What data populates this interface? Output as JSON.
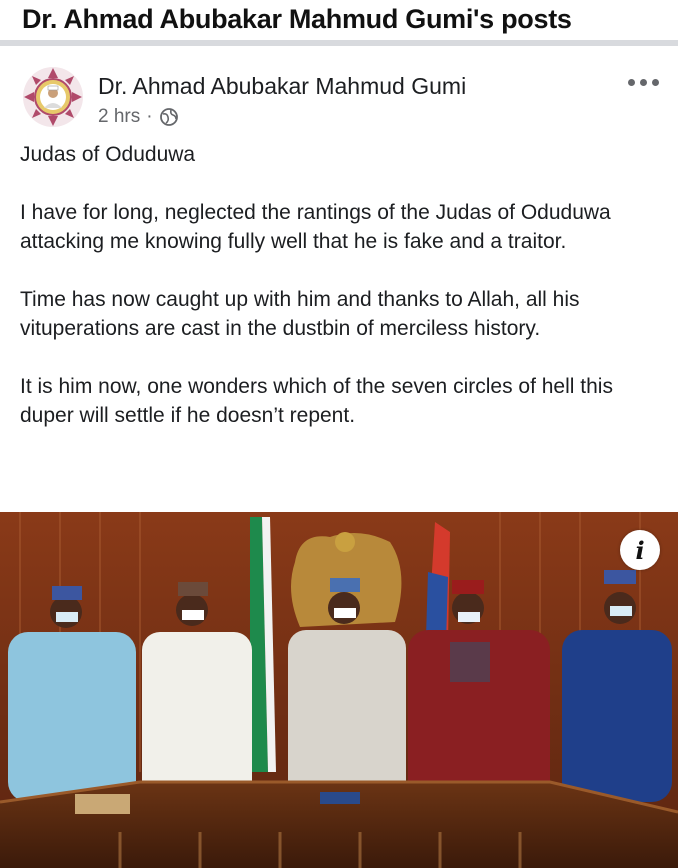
{
  "page": {
    "title": "Dr. Ahmad Abubakar Mahmud Gumi's posts"
  },
  "post": {
    "author": "Dr. Ahmad Abubakar Mahmud Gumi",
    "time": "2 hrs",
    "separator": "·",
    "privacy_icon": "globe-icon",
    "more_icon": "more-options-icon",
    "paragraphs": [
      "Judas of Oduduwa",
      "I have for long, neglected the rantings of the Judas of Oduduwa attacking me knowing fully well that he is fake and a traitor.",
      "Time has now caught up with him and thanks to Allah, all his vituperations are cast in the dustbin of merciless history.",
      "It is him now, one wonders which of the seven circles of hell this duper will settle if he doesn’t repent."
    ],
    "photo": {
      "info_label": "i"
    }
  }
}
